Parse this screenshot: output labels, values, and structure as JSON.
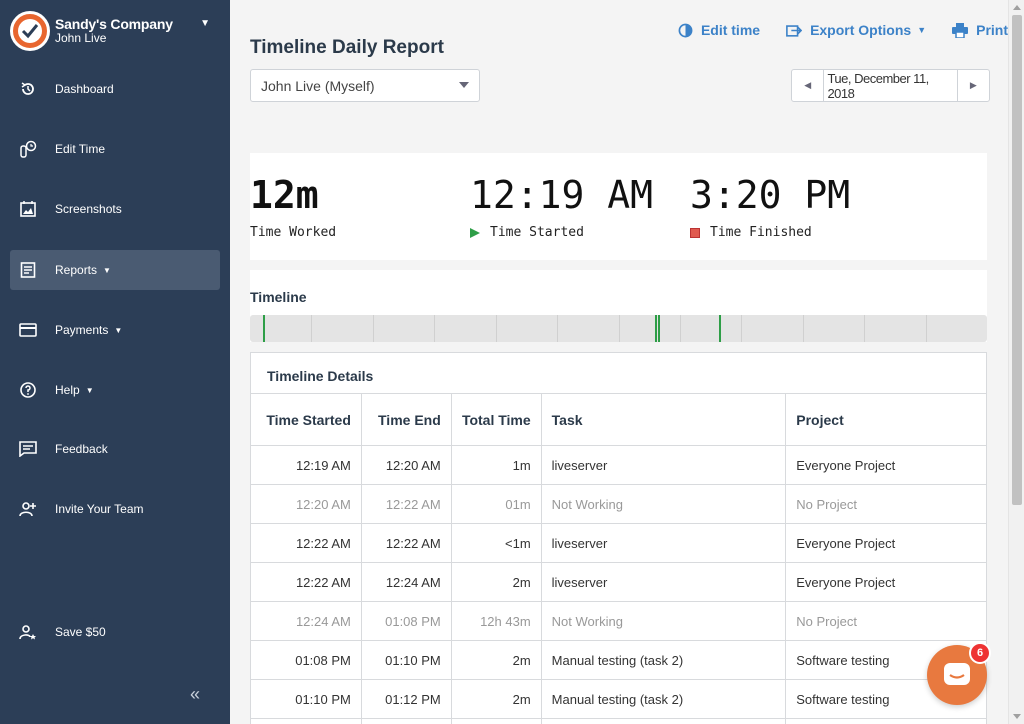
{
  "sidebar": {
    "company_name": "Sandy's Company",
    "user_name": "John Live",
    "items": [
      {
        "label": "Dashboard",
        "icon": "history-icon"
      },
      {
        "label": "Edit Time",
        "icon": "edit-time-icon"
      },
      {
        "label": "Screenshots",
        "icon": "screenshots-icon"
      },
      {
        "label": "Reports",
        "icon": "reports-icon",
        "active": true,
        "has_dropdown": true
      },
      {
        "label": "Payments",
        "icon": "card-icon",
        "has_dropdown": true
      },
      {
        "label": "Help",
        "icon": "help-icon",
        "has_dropdown": true
      },
      {
        "label": "Feedback",
        "icon": "feedback-icon"
      },
      {
        "label": "Invite Your Team",
        "icon": "add-user-icon"
      },
      {
        "label": "Save $50",
        "icon": "user-star-icon"
      }
    ],
    "collapse_glyph": "«"
  },
  "header": {
    "title": "Timeline Daily Report",
    "edit_time": "Edit time",
    "export_options": "Export Options",
    "print": "Print"
  },
  "filters": {
    "user": "John Live (Myself)",
    "date": "Tue, December 11, 2018"
  },
  "summary": {
    "worked_value": "12m",
    "worked_label": "Time Worked",
    "started_value": "12:19 AM",
    "started_label": "Time Started",
    "finished_value": "3:20 PM",
    "finished_label": "Time Finished"
  },
  "timeline": {
    "title": "Timeline",
    "activity_fractions": [
      0.018,
      0.55,
      0.554,
      0.637
    ]
  },
  "details": {
    "title": "Timeline Details",
    "columns": [
      "Time Started",
      "Time End",
      "Total Time",
      "Task",
      "Project"
    ],
    "rows": [
      {
        "start": "12:19 AM",
        "end": "12:20 AM",
        "total": "1m",
        "task": "liveserver",
        "project": "Everyone Project",
        "muted": false
      },
      {
        "start": "12:20 AM",
        "end": "12:22 AM",
        "total": "01m",
        "task": "Not Working",
        "project": "No Project",
        "muted": true
      },
      {
        "start": "12:22 AM",
        "end": "12:22 AM",
        "total": "<1m",
        "task": "liveserver",
        "project": "Everyone Project",
        "muted": false
      },
      {
        "start": "12:22 AM",
        "end": "12:24 AM",
        "total": "2m",
        "task": "liveserver",
        "project": "Everyone Project",
        "muted": false
      },
      {
        "start": "12:24 AM",
        "end": "01:08 PM",
        "total": "12h 43m",
        "task": "Not Working",
        "project": "No Project",
        "muted": true
      },
      {
        "start": "01:08 PM",
        "end": "01:10 PM",
        "total": "2m",
        "task": "Manual testing (task 2)",
        "project": "Software testing",
        "muted": false
      },
      {
        "start": "01:10 PM",
        "end": "01:12 PM",
        "total": "2m",
        "task": "Manual testing (task 2)",
        "project": "Software testing",
        "muted": false
      },
      {
        "start": "",
        "end": "",
        "total": "",
        "task": "",
        "project": "",
        "muted": false
      }
    ]
  },
  "chat": {
    "badge_count": "6"
  },
  "colors": {
    "sidebar": "#2c3e57",
    "accent": "#3c82c8",
    "active_green": "#2e9e47",
    "brand_orange": "#e8662f"
  }
}
